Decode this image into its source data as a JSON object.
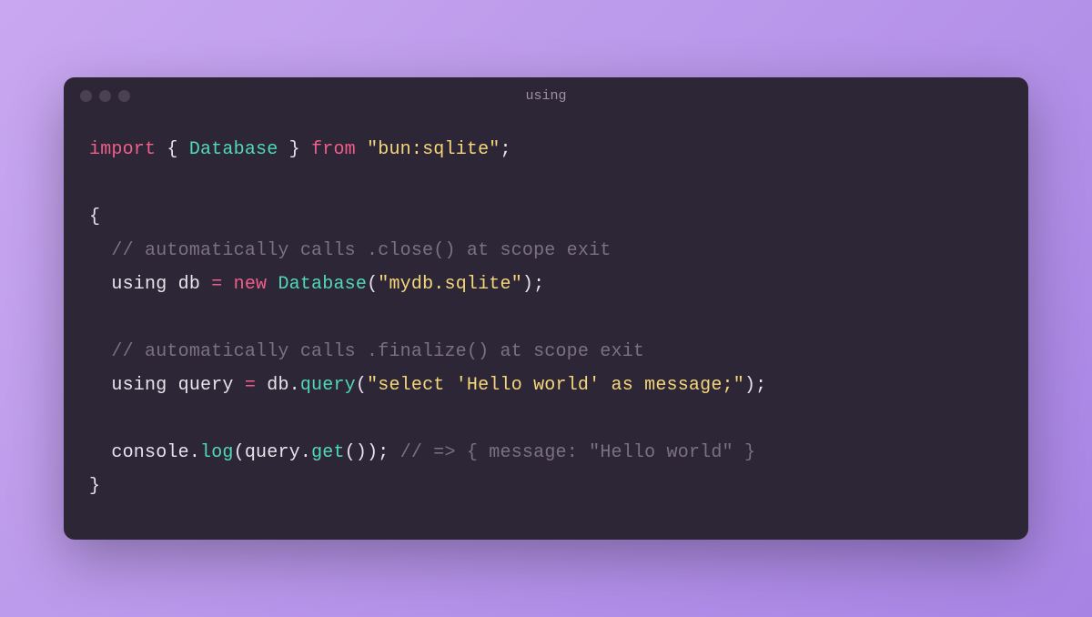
{
  "window": {
    "title": "using"
  },
  "code": {
    "line1": {
      "import": "import",
      "lbrace": " { ",
      "class": "Database",
      "rbrace": " } ",
      "from": "from",
      "space": " ",
      "string": "\"bun:sqlite\"",
      "semi": ";"
    },
    "line3": {
      "brace": "{"
    },
    "line4": {
      "indent": "  ",
      "comment": "// automatically calls .close() at scope exit"
    },
    "line5": {
      "indent": "  ",
      "using": "using",
      "space1": " ",
      "var": "db",
      "space2": " ",
      "eq": "=",
      "space3": " ",
      "new": "new",
      "space4": " ",
      "class": "Database",
      "lparen": "(",
      "string": "\"mydb.sqlite\"",
      "rparen": ")",
      "semi": ";"
    },
    "line7": {
      "indent": "  ",
      "comment": "// automatically calls .finalize() at scope exit"
    },
    "line8": {
      "indent": "  ",
      "using": "using",
      "space1": " ",
      "var": "query",
      "space2": " ",
      "eq": "=",
      "space3": " ",
      "obj": "db",
      "dot": ".",
      "method": "query",
      "lparen": "(",
      "string": "\"select 'Hello world' as message;\"",
      "rparen": ")",
      "semi": ";"
    },
    "line10": {
      "indent": "  ",
      "obj": "console",
      "dot1": ".",
      "method1": "log",
      "lparen1": "(",
      "arg": "query",
      "dot2": ".",
      "method2": "get",
      "lparen2": "(",
      "rparen2": ")",
      "rparen1": ")",
      "semi": ";",
      "space": " ",
      "comment": "// => { message: \"Hello world\" }"
    },
    "line11": {
      "brace": "}"
    }
  }
}
